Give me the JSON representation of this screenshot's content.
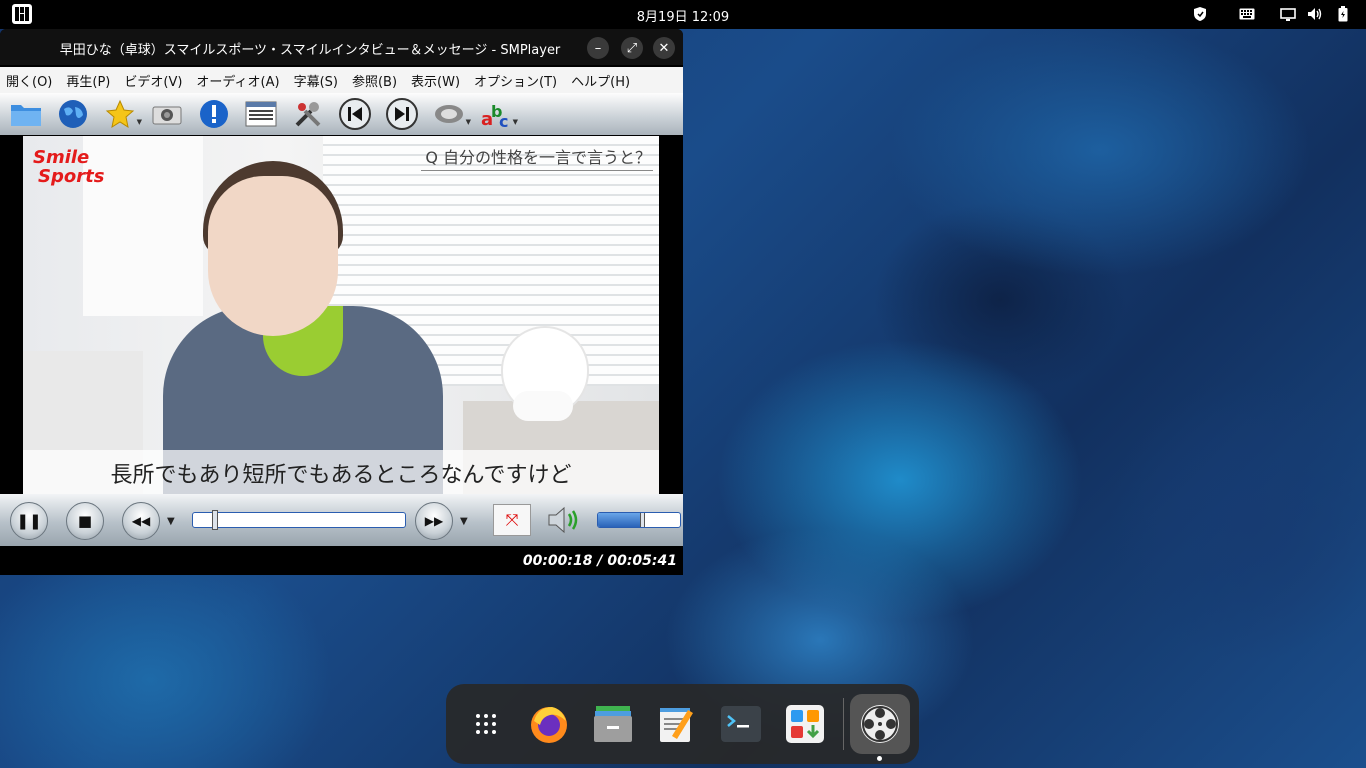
{
  "topbar": {
    "clock": "8月19日  12:09",
    "tray_icons": [
      "shield-icon",
      "keyboard-icon",
      "display-icon",
      "volume-icon",
      "battery-icon"
    ]
  },
  "window": {
    "title": "早田ひな（卓球）スマイルスポーツ・スマイルインタビュー＆メッセージ - SMPlayer",
    "controls": {
      "minimize": "–",
      "maximize": "⤢",
      "close": "✕"
    }
  },
  "menu": [
    "開く(O)",
    "再生(P)",
    "ビデオ(V)",
    "オーディオ(A)",
    "字幕(S)",
    "参照(B)",
    "表示(W)",
    "オプション(T)",
    "ヘルプ(H)"
  ],
  "toolbar": [
    "open-folder-icon",
    "globe-icon",
    "favorites-star-icon",
    "screenshot-camera-icon",
    "info-icon",
    "playlist-icon",
    "preferences-tools-icon",
    "previous-icon",
    "next-icon",
    "audio-track-icon",
    "subtitles-icon"
  ],
  "video": {
    "logo_line1": "Smile",
    "logo_line2": "Sports",
    "question": "Q 自分の性格を一言で言うと？",
    "subtitle": "長所でもあり短所でもあるところなんですけど"
  },
  "controls": {
    "pause": "❚❚",
    "stop": "■",
    "rewind": "◀◀",
    "forward": "▶▶",
    "fullscreen": "⤧",
    "seek_position": 0.053,
    "volume_level": 0.5
  },
  "status": {
    "time": "00:00:18 / 00:05:41"
  },
  "dock": {
    "apps": [
      "app-grid-icon",
      "firefox-icon",
      "files-icon",
      "text-editor-icon",
      "terminal-icon",
      "software-store-icon",
      "smplayer-icon"
    ]
  }
}
